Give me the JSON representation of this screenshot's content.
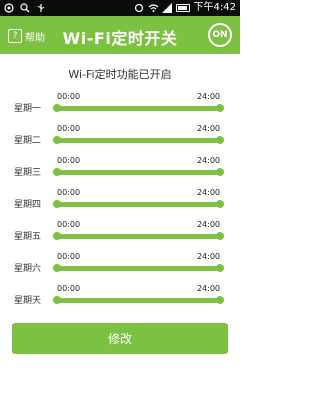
{
  "status_bar": {
    "time": "下午4:42",
    "icons": [
      "android-icon",
      "search-icon",
      "usb-icon",
      "sync-icon",
      "wifi-icon",
      "signal-icon",
      "battery-icon"
    ]
  },
  "header": {
    "help_label": "帮助",
    "help_icon": "?",
    "title": "Wi-Fi定时开关",
    "toggle_label": "ON"
  },
  "status_message": "Wi-Fi定时功能已开启",
  "schedule": [
    {
      "day": "星期一",
      "start": "00:00",
      "end": "24:00"
    },
    {
      "day": "星期二",
      "start": "00:00",
      "end": "24:00"
    },
    {
      "day": "星期三",
      "start": "00:00",
      "end": "24:00"
    },
    {
      "day": "星期四",
      "start": "00:00",
      "end": "24:00"
    },
    {
      "day": "星期五",
      "start": "00:00",
      "end": "24:00"
    },
    {
      "day": "星期六",
      "start": "00:00",
      "end": "24:00"
    },
    {
      "day": "星期天",
      "start": "00:00",
      "end": "24:00"
    }
  ],
  "modify_label": "修改",
  "colors": {
    "accent": "#7cc142",
    "status_bar": "#0c0c0c"
  }
}
